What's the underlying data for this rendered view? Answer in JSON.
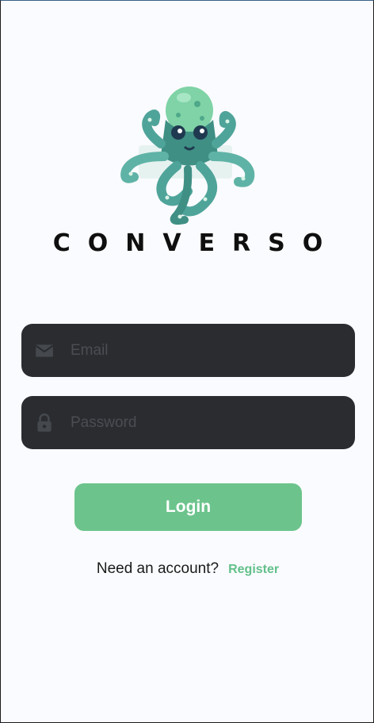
{
  "app": {
    "brand_name": "CONVERSO",
    "logo_icon": "octopus-logo-icon"
  },
  "form": {
    "email": {
      "icon": "envelope-icon",
      "placeholder": "Email",
      "value": ""
    },
    "password": {
      "icon": "lock-icon",
      "placeholder": "Password",
      "value": ""
    },
    "login_label": "Login"
  },
  "footer": {
    "prompt": "Need an account?",
    "register_label": "Register"
  },
  "colors": {
    "background": "#fafbfe",
    "field_background": "#2a2c30",
    "accent": "#6cc48c",
    "brand_text": "#0f0f0f"
  }
}
